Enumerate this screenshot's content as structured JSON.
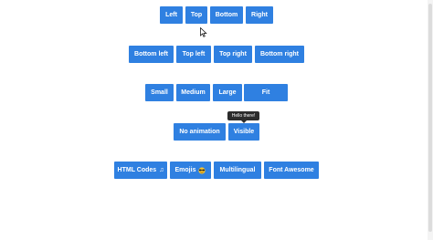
{
  "row1": {
    "left": "Left",
    "top": "Top",
    "bottom": "Bottom",
    "right": "Right"
  },
  "row2": {
    "bottom_left": "Bottom left",
    "top_left": "Top left",
    "top_right": "Top right",
    "bottom_right": "Bottom right"
  },
  "row3": {
    "small": "Small",
    "medium": "Medium",
    "large": "Large",
    "fit": "Fit"
  },
  "row4": {
    "no_animation": "No animation",
    "visible": "Visible",
    "tooltip": "Hello there!"
  },
  "row5": {
    "html_codes": "HTML Codes",
    "html_codes_glyph": "♫",
    "emojis": "Emojis",
    "emojis_glyph": "😎",
    "multilingual": "Multilingual",
    "font_awesome": "Font Awesome"
  },
  "colors": {
    "button": "#2f80e1",
    "tooltip": "#2c2c2c"
  },
  "icons": {
    "cursor": "mouse-pointer-icon",
    "music": "music-note-icon",
    "emoji": "sunglasses-emoji-icon"
  }
}
